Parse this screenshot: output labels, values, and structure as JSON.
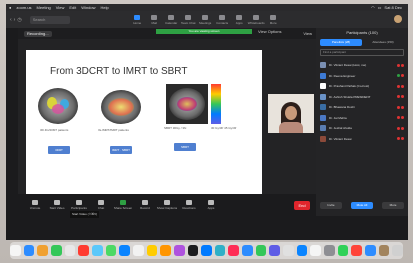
{
  "menubar": {
    "app": "zoom.us",
    "items": [
      "Meeting",
      "View",
      "Edit",
      "Window",
      "Help"
    ],
    "right": [
      "Sat 8 Dec"
    ]
  },
  "zoom_nav": {
    "search_placeholder": "Search",
    "tabs": [
      {
        "label": "Home",
        "active": true
      },
      {
        "label": "Mail",
        "active": false
      },
      {
        "label": "Calendar",
        "active": false
      },
      {
        "label": "Team Chat",
        "active": false
      },
      {
        "label": "Meetings",
        "active": false
      },
      {
        "label": "Contacts",
        "active": false
      },
      {
        "label": "Apps",
        "active": false
      },
      {
        "label": "Whiteboards",
        "active": false
      },
      {
        "label": "More",
        "active": false
      }
    ]
  },
  "meeting": {
    "recording": "Recording...",
    "status_bar": "You are viewing screen",
    "view_label": "View Options",
    "layout_label": "View",
    "slide": {
      "title": "From 3DCRT to IMRT to SBRT",
      "captions": [
        "3D 4fx/20M7 patients",
        "IG-IMRT/IMRT patients",
        "SBRT 30Gy / 3fx",
        "30 Gy/3fr 45 Gy/3fr"
      ],
      "buttons": [
        "3DRT",
        "IMRT · SBRT",
        "SBRT"
      ]
    },
    "toolbar": [
      {
        "label": "Unmute",
        "green": false
      },
      {
        "label": "Start Video",
        "green": false
      },
      {
        "label": "Participants",
        "green": false
      },
      {
        "label": "Chat",
        "green": false
      },
      {
        "label": "Share Screen",
        "green": true
      },
      {
        "label": "Record",
        "green": false
      },
      {
        "label": "Show Captions",
        "green": false
      },
      {
        "label": "Reactions",
        "green": false
      },
      {
        "label": "Apps",
        "green": false
      }
    ],
    "end_label": "End",
    "tooltip": "Start Video (⇧⌘V)"
  },
  "participants": {
    "title": "Participants (100)",
    "tabs": [
      {
        "label": "Panelists (28)",
        "active": true
      },
      {
        "label": "Attendees (150)",
        "active": false
      }
    ],
    "search_placeholder": "Find a participant",
    "list": [
      {
        "name": "Dr. Vikrant Desai (Host, me)",
        "color": "#7a8fb3",
        "mic": "r",
        "cam": "r"
      },
      {
        "name": "Dr. Reena Engineer",
        "color": "#3d7bd6",
        "mic": "g",
        "cam": "r"
      },
      {
        "name": "Dr. Prashant Pathak (Co-host)",
        "color": "#ffffff",
        "mic": "r",
        "cam": "r"
      },
      {
        "name": "Dr. Ashish Shukla PRESIDENT",
        "color": "#6a93c8",
        "mic": "r",
        "cam": "r"
      },
      {
        "name": "Dr. Bhawana Doshi",
        "color": "#3a6ea5",
        "mic": "r",
        "cam": "r"
      },
      {
        "name": "Dr. Jai Mehta",
        "color": "#4b78c4",
        "mic": "r",
        "cam": "r"
      },
      {
        "name": "Dr. Jeshal shukla",
        "color": "#5a7db1",
        "mic": "r",
        "cam": "r"
      },
      {
        "name": "Dr. Vikrant Desai",
        "color": "#8b4a3a",
        "mic": "r",
        "cam": "r"
      }
    ],
    "footer": [
      {
        "label": "Invite",
        "blue": false
      },
      {
        "label": "Mute All",
        "blue": true
      },
      {
        "label": "More",
        "blue": false
      }
    ]
  },
  "dock_colors": [
    "#f5f5f5",
    "#2d8cff",
    "#f0a030",
    "#34c759",
    "#e8e8e8",
    "#ff3b30",
    "#5ac8fa",
    "#4cd964",
    "#0a84ff",
    "#f2f2f2",
    "#ffcc00",
    "#ff9500",
    "#af52de",
    "#1c1c1e",
    "#007aff",
    "#30b0c7",
    "#ff2d55",
    "#2d8cff",
    "#34c759",
    "#5e5ce6",
    "#e0e0e0",
    "#0a84ff",
    "#f5f5f5",
    "#8e8e93",
    "#30d158",
    "#ff453a",
    "#2d8cff",
    "#a2845e",
    "#d0d0d0"
  ]
}
